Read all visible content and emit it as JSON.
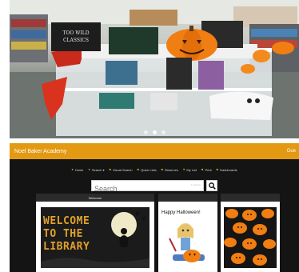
{
  "photo": {
    "sign_left": "TOO WILD\nCLASSICS",
    "dots": 3,
    "active_dot": 1
  },
  "site": {
    "title": "Noel Baker Academy",
    "header_right": "Gue",
    "nav": [
      {
        "label": "Home",
        "icon": "home-icon"
      },
      {
        "label": "Search ▾",
        "icon": "search-icon"
      },
      {
        "label": "Visual Search",
        "icon": "grid-icon"
      },
      {
        "label": "Quick Lists",
        "icon": "list-icon"
      },
      {
        "label": "Reserves",
        "icon": "bookmark-icon"
      },
      {
        "label": "My List",
        "icon": "heart-icon"
      },
      {
        "label": "Print",
        "icon": "print-icon"
      },
      {
        "label": "Dashboards",
        "icon": "dashboard-icon"
      }
    ],
    "search": {
      "placeholder": "Search",
      "hint": "▾ options"
    },
    "cards": {
      "welcome_header": "Welcome",
      "welcome_image_text": [
        "WELCOME",
        "TO THE",
        "LIBRARY"
      ],
      "halloween_title": "Happy Halloween!"
    }
  },
  "colors": {
    "header": "#e39a12",
    "site_bg": "#141414",
    "nav_icon": "#e3a019",
    "pumpkin": "#f07e12"
  }
}
